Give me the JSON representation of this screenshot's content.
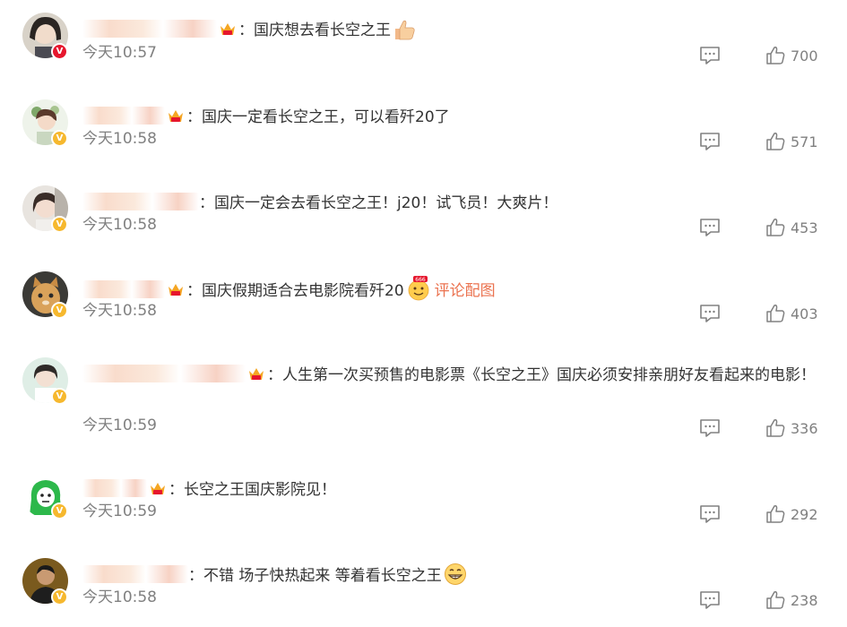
{
  "comments": [
    {
      "text": "：国庆想去看长空之王",
      "emoji": "thumbs-up-icon",
      "time": "今天10:57",
      "likes": "700",
      "badge": "red"
    },
    {
      "text": "：国庆一定看长空之王，可以看歼20了",
      "time": "今天10:58",
      "likes": "571",
      "badge": "gold"
    },
    {
      "text": "：国庆一定会去看长空之王！j20！试飞员！大爽片！",
      "time": "今天10:58",
      "likes": "453",
      "badge": "gold"
    },
    {
      "text": "：国庆假期适合去电影院看歼20",
      "emoji": "666-face-icon",
      "pic_link": "评论配图",
      "time": "今天10:58",
      "likes": "403",
      "badge": "gold"
    },
    {
      "text": "：人生第一次买预售的电影票《长空之王》国庆必须安排亲朋好友看起来的电影！",
      "time": "今天10:59",
      "likes": "336",
      "badge": "gold"
    },
    {
      "text": "：长空之王国庆影院见！",
      "time": "今天10:59",
      "likes": "292",
      "badge": "gold"
    },
    {
      "text": "：不错 场子快热起来 等着看长空之王",
      "emoji": "grin-icon",
      "time": "今天10:58",
      "likes": "238",
      "badge": "gold"
    }
  ],
  "icons": {
    "reply": "comment-icon",
    "like": "thumbs-up-outline-icon",
    "member": "crown-icon",
    "verified": "v-badge-icon"
  },
  "colors": {
    "text": "#333333",
    "meta": "#808080",
    "link": "#eb7350",
    "badge_red": "#e6162d",
    "badge_gold": "#f6b82e"
  }
}
